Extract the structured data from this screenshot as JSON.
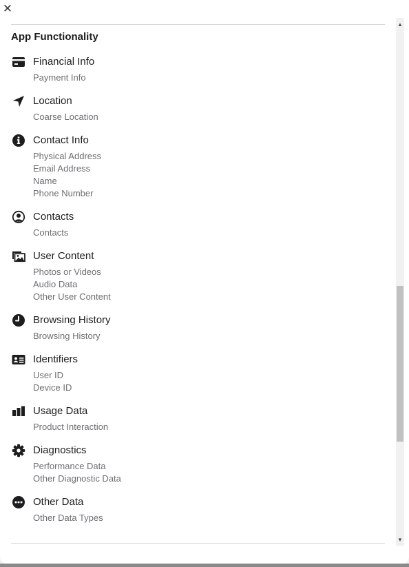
{
  "close_glyph": "✕",
  "section_title": "App Functionality",
  "items": [
    {
      "title": "Financial Info",
      "icon": "credit-card-icon",
      "subs": [
        "Payment Info"
      ]
    },
    {
      "title": "Location",
      "icon": "location-arrow-icon",
      "subs": [
        "Coarse Location"
      ]
    },
    {
      "title": "Contact Info",
      "icon": "info-circle-icon",
      "subs": [
        "Physical Address",
        "Email Address",
        "Name",
        "Phone Number"
      ]
    },
    {
      "title": "Contacts",
      "icon": "user-circle-icon",
      "subs": [
        "Contacts"
      ]
    },
    {
      "title": "User Content",
      "icon": "photos-icon",
      "subs": [
        "Photos or Videos",
        "Audio Data",
        "Other User Content"
      ]
    },
    {
      "title": "Browsing History",
      "icon": "clock-icon",
      "subs": [
        "Browsing History"
      ]
    },
    {
      "title": "Identifiers",
      "icon": "id-card-icon",
      "subs": [
        "User ID",
        "Device ID"
      ]
    },
    {
      "title": "Usage Data",
      "icon": "bar-chart-icon",
      "subs": [
        "Product Interaction"
      ]
    },
    {
      "title": "Diagnostics",
      "icon": "gear-icon",
      "subs": [
        "Performance Data",
        "Other Diagnostic Data"
      ]
    },
    {
      "title": "Other Data",
      "icon": "more-circle-icon",
      "subs": [
        "Other Data Types"
      ]
    }
  ],
  "scrollbar": {
    "up_glyph": "▲",
    "down_glyph": "▼",
    "position": 0.75
  }
}
